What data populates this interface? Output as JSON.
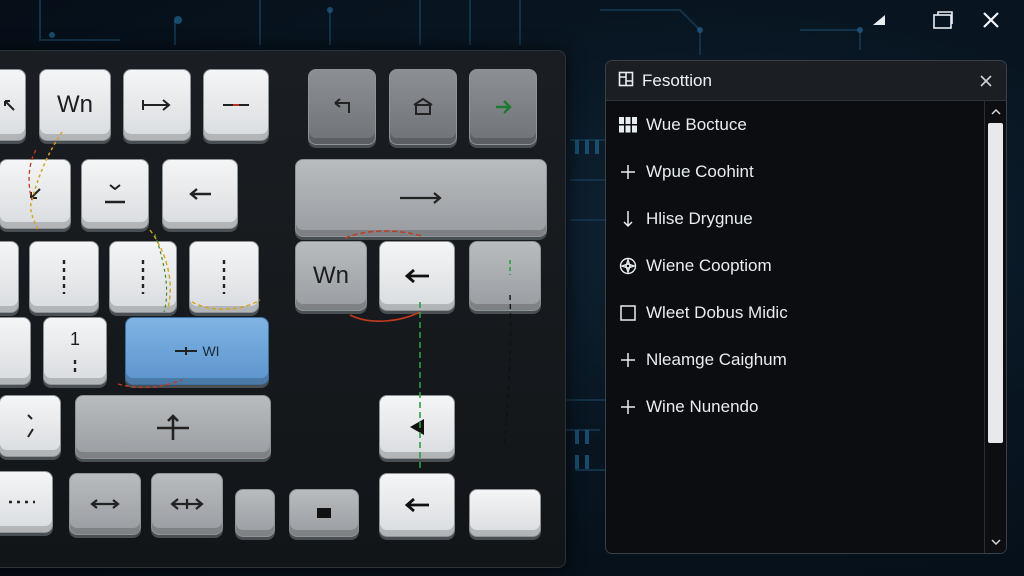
{
  "window_controls": {
    "signal_icon": "signal-icon",
    "restore_icon": "restore-icon",
    "close_icon": "close-icon"
  },
  "keyboard": {
    "keys": {
      "wn_top": "Wn",
      "wn_mid": "Wn",
      "blue_key": "WI",
      "num_1": "1"
    }
  },
  "panel": {
    "title": "Fesottion",
    "items": [
      {
        "label": "Wue Boctuce",
        "icon": "grid-icon"
      },
      {
        "label": "Wpue Coohint",
        "icon": "plus-icon"
      },
      {
        "label": "Hlise Drygnue",
        "icon": "down-arrow-icon"
      },
      {
        "label": "Wiene Cooptiom",
        "icon": "compass-icon"
      },
      {
        "label": "Wleet Dobus Midic",
        "icon": "square-icon"
      },
      {
        "label": "Nleamge Caighum",
        "icon": "plus-icon"
      },
      {
        "label": "Wine Nunendo",
        "icon": "plus-icon"
      }
    ]
  },
  "colors": {
    "accent_blue": "#6aa3d8",
    "panel_bg": "#0b0d10",
    "circuit": "#17405c"
  }
}
